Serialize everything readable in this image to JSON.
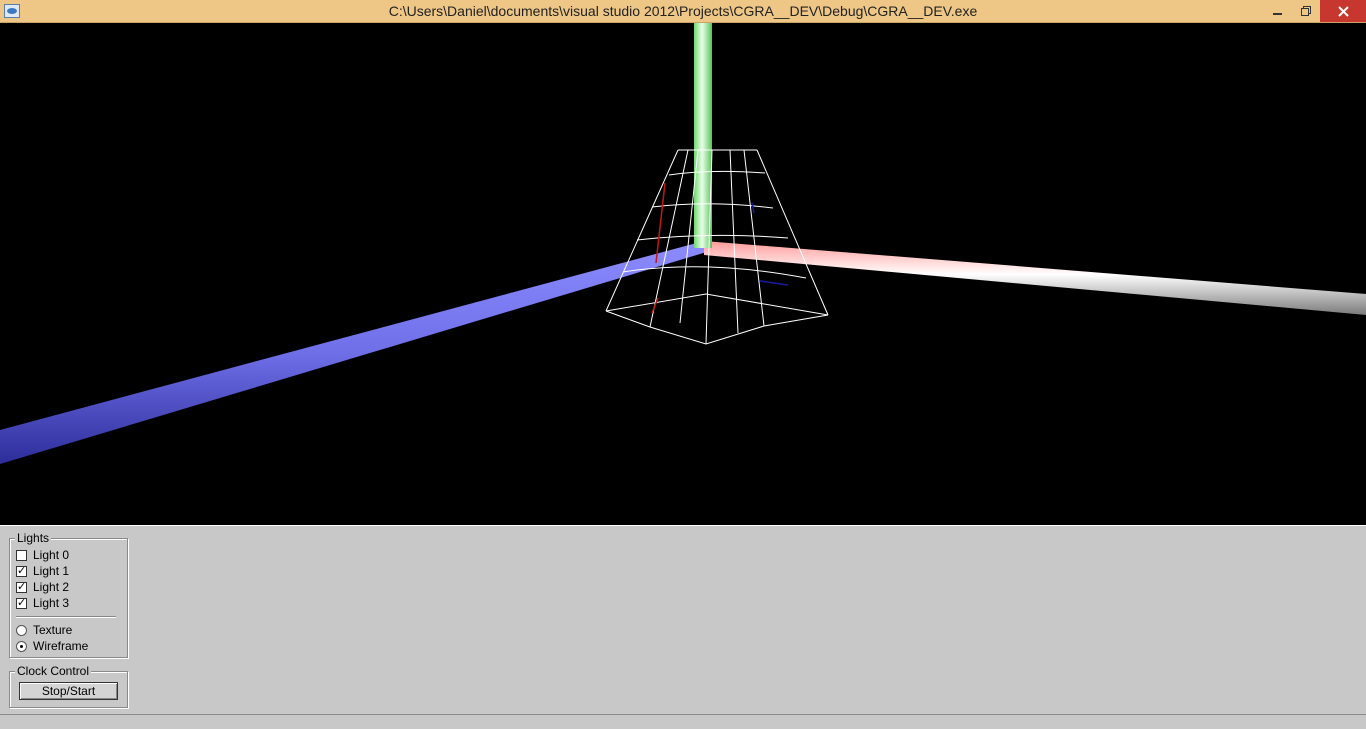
{
  "window": {
    "title": "C:\\Users\\Daniel\\documents\\visual studio 2012\\Projects\\CGRA__DEV\\Debug\\CGRA__DEV.exe",
    "minimize_icon": "minimize-icon",
    "restore_icon": "restore-icon",
    "close_icon": "close-icon"
  },
  "scene": {
    "x_axis_color": "#ffd6d6",
    "y_axis_color": "#8cff8c",
    "z_axis_color": "#7b7bff",
    "wireframe_color": "#ffffff",
    "background": "#000000"
  },
  "lights_panel": {
    "title": "Lights",
    "items": [
      {
        "label": "Light 0",
        "checked": false
      },
      {
        "label": "Light 1",
        "checked": true
      },
      {
        "label": "Light 2",
        "checked": true
      },
      {
        "label": "Light 3",
        "checked": true
      }
    ],
    "modes": [
      {
        "label": "Texture",
        "selected": false
      },
      {
        "label": "Wireframe",
        "selected": true
      }
    ]
  },
  "clock_panel": {
    "title": "Clock Control",
    "button_label": "Stop/Start"
  }
}
